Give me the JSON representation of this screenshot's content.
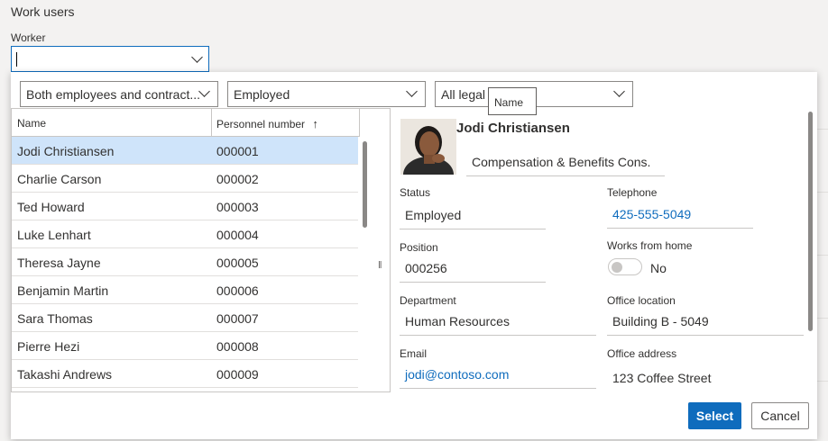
{
  "page": {
    "title": "Work users",
    "worker_label": "Worker",
    "worker_value": ""
  },
  "filters": {
    "worker_type": "Both employees and contract...",
    "status": "Employed",
    "legal_entity": "All legal",
    "tooltip": "Name"
  },
  "grid": {
    "columns": [
      "Name",
      "Personnel number"
    ],
    "sort_indicator": "↑",
    "rows": [
      {
        "name": "Jodi Christiansen",
        "number": "000001"
      },
      {
        "name": "Charlie Carson",
        "number": "000002"
      },
      {
        "name": "Ted Howard",
        "number": "000003"
      },
      {
        "name": "Luke Lenhart",
        "number": "000004"
      },
      {
        "name": "Theresa Jayne",
        "number": "000005"
      },
      {
        "name": "Benjamin Martin",
        "number": "000006"
      },
      {
        "name": "Sara Thomas",
        "number": "000007"
      },
      {
        "name": "Pierre Hezi",
        "number": "000008"
      },
      {
        "name": "Takashi Andrews",
        "number": "000009"
      }
    ],
    "splitter_glyph": "‖"
  },
  "detail": {
    "name": "Jodi Christiansen",
    "job_title": "Compensation & Benefits Cons.",
    "status_label": "Status",
    "status": "Employed",
    "telephone_label": "Telephone",
    "telephone": "425-555-5049",
    "position_label": "Position",
    "position": "000256",
    "works_from_home_label": "Works from home",
    "works_from_home": "No",
    "department_label": "Department",
    "department": "Human Resources",
    "office_location_label": "Office location",
    "office_location": "Building B - 5049",
    "email_label": "Email",
    "email": "jodi@contoso.com",
    "office_address_label": "Office address",
    "office_address": "123 Coffee Street"
  },
  "buttons": {
    "select": "Select",
    "cancel": "Cancel"
  },
  "colors": {
    "accent": "#0f6cbd",
    "selected_row": "#cfe4fa"
  }
}
